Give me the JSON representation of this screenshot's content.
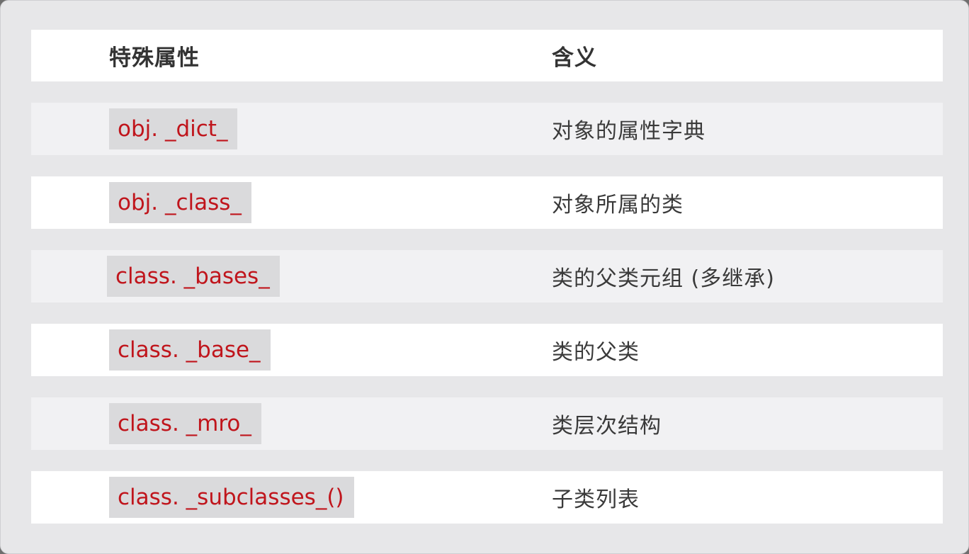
{
  "table": {
    "headers": {
      "attribute": "特殊属性",
      "meaning": "含义"
    },
    "rows": [
      {
        "attribute": "obj. _dict_",
        "meaning": "对象的属性字典"
      },
      {
        "attribute": "obj. _class_",
        "meaning": "对象所属的类"
      },
      {
        "attribute": "class. _bases_",
        "meaning": "类的父类元组 (多继承)"
      },
      {
        "attribute": "class. _base_",
        "meaning": "类的父类"
      },
      {
        "attribute": "class. _mro_",
        "meaning": "类层次结构"
      },
      {
        "attribute": "class. _subclasses_()",
        "meaning": "子类列表"
      }
    ]
  },
  "colors": {
    "code_text": "#c0151c",
    "code_background": "#dadadc",
    "row_white": "#ffffff",
    "row_gray": "#f1f1f3",
    "page_background": "#e7e7e9"
  }
}
